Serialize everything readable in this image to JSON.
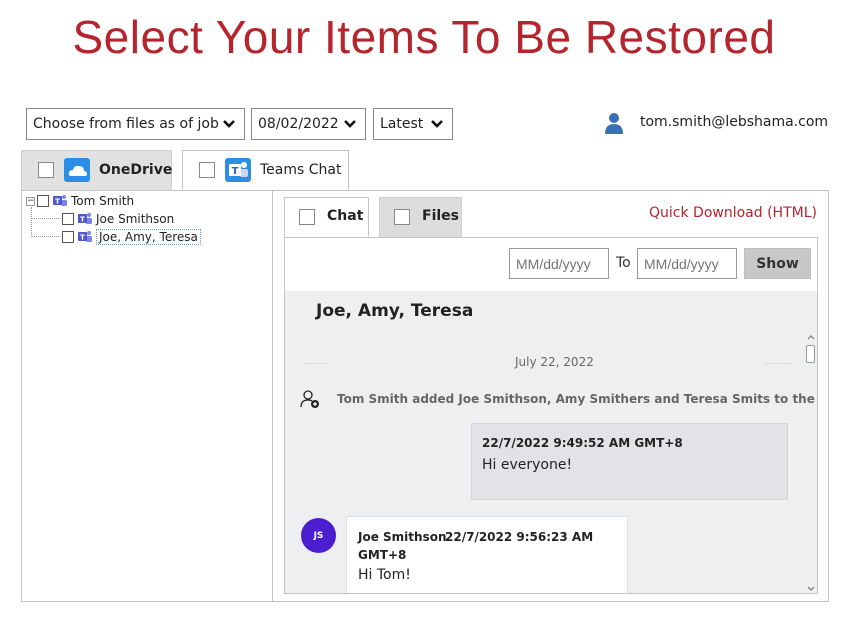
{
  "page": {
    "title": "Select Your Items To Be Restored"
  },
  "filters": {
    "source": {
      "selected": "Choose from files as of job"
    },
    "date": {
      "selected": "08/02/2022"
    },
    "version": {
      "selected": "Latest"
    }
  },
  "user": {
    "email": "tom.smith@lebshama.com",
    "icon": "user-icon"
  },
  "tabs": [
    {
      "label": "OneDrive",
      "icon": "onedrive-icon",
      "active": false
    },
    {
      "label": "Teams Chat",
      "icon": "teams-icon",
      "active": true
    }
  ],
  "tree": {
    "root": {
      "label": "Tom Smith",
      "icon": "teams-icon"
    },
    "children": [
      {
        "label": "Joe Smithson",
        "icon": "teams-icon"
      },
      {
        "label": "Joe, Amy, Teresa",
        "icon": "teams-icon",
        "selected": true
      }
    ]
  },
  "subtabs": [
    {
      "label": "Chat",
      "active": true
    },
    {
      "label": "Files",
      "active": false
    }
  ],
  "quick_download": "Quick Download (HTML)",
  "date_range": {
    "from_placeholder": "MM/dd/yyyy",
    "to_label": "To",
    "to_placeholder": "MM/dd/yyyy",
    "show_label": "Show"
  },
  "conversation": {
    "title": "Joe, Amy, Teresa",
    "day_separator": "July 22, 2022",
    "system_message": "Tom Smith added Joe Smithson, Amy Smithers and Teresa Smits to the chat.",
    "messages": [
      {
        "timestamp": "22/7/2022 9:49:52 AM GMT+8",
        "text": "Hi everyone!"
      },
      {
        "avatar": "JS",
        "sender": "Joe Smithson",
        "timestamp_line1": "22/7/2022 9:56:23 AM",
        "timestamp_line2": "GMT+8",
        "text": "Hi Tom!"
      }
    ]
  },
  "colors": {
    "accent": "#b5252e",
    "avatar": "#4b1fcf",
    "teams": "#5059c9",
    "onedrive": "#1e88e5"
  }
}
